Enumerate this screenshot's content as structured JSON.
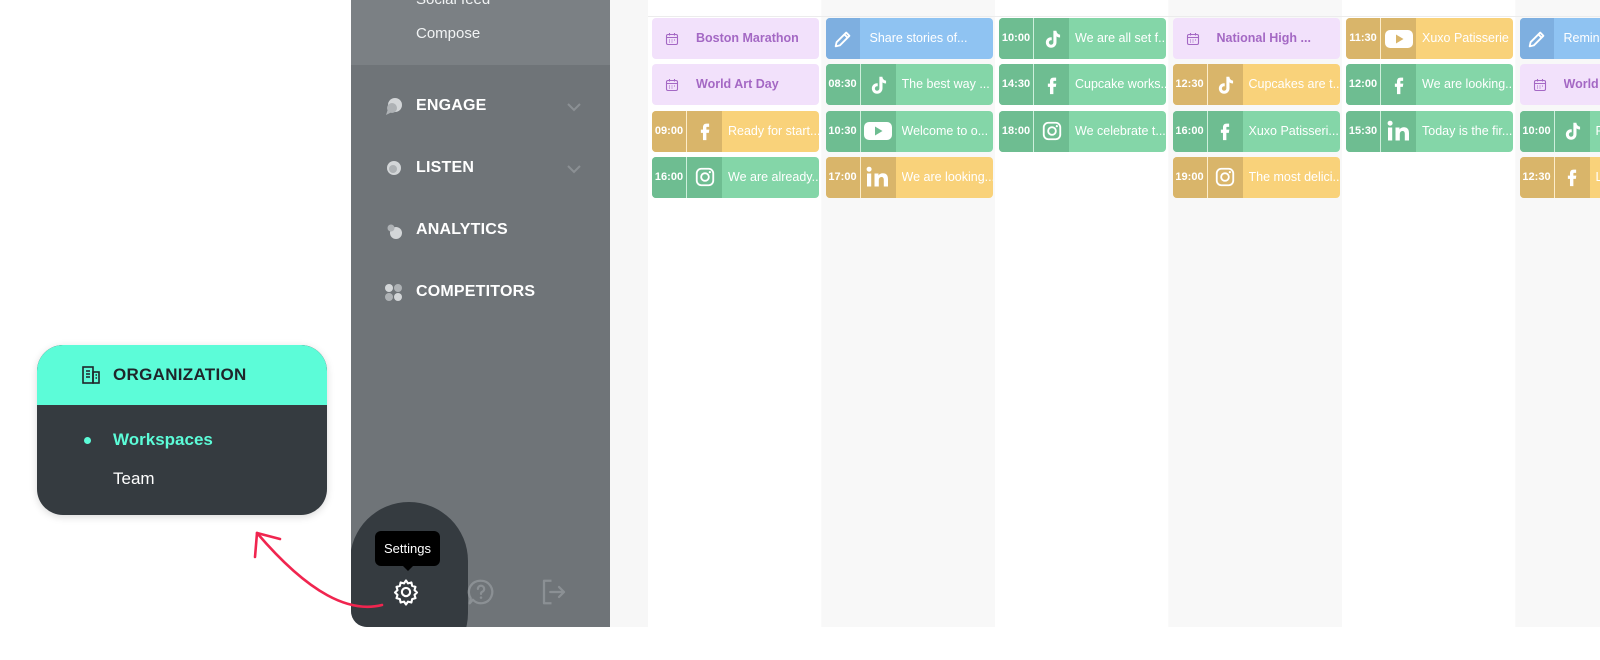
{
  "sidebar": {
    "sub_items": [
      "Social feed",
      "Compose"
    ],
    "nav": [
      {
        "label": "ENGAGE",
        "icon": "engage-icon",
        "has_chevron": true
      },
      {
        "label": "LISTEN",
        "icon": "listen-icon",
        "has_chevron": true
      },
      {
        "label": "ANALYTICS",
        "icon": "analytics-icon",
        "has_chevron": false
      },
      {
        "label": "COMPETITORS",
        "icon": "competitors-icon",
        "has_chevron": false
      }
    ],
    "footer_icons": [
      "gear-icon",
      "help-icon",
      "logout-icon"
    ]
  },
  "tooltip": "Settings",
  "organization": {
    "title": "ORGANIZATION",
    "items": [
      "Workspaces",
      "Team"
    ],
    "active": "Workspaces"
  },
  "colors": {
    "accent": "#5cfcd8",
    "sidebar_bg": "#6f7478",
    "card_bg": "#353b40",
    "arrow": "#f0254f",
    "event": "#f2e1fb",
    "event_text": "#a468c4",
    "note": "#8fc3f2",
    "green": "#84d6a8",
    "green_dark": "#6ebd91",
    "yellow": "#f9d27a",
    "yellow_dark": "#d9b56a"
  },
  "calendar": {
    "days": [
      {
        "cards": [
          {
            "kind": "event",
            "text": "Boston Marathon"
          },
          {
            "kind": "event",
            "text": "World Art Day"
          },
          {
            "kind": "post",
            "time": "09:00",
            "network": "facebook",
            "color": "yellow",
            "text": "Ready for start..."
          },
          {
            "kind": "post",
            "time": "16:00",
            "network": "instagram",
            "color": "green",
            "text": "We are already..."
          }
        ]
      },
      {
        "cards": [
          {
            "kind": "note",
            "text": "Share stories of..."
          },
          {
            "kind": "post",
            "time": "08:30",
            "network": "tiktok",
            "color": "green",
            "text": "The best way ..."
          },
          {
            "kind": "post",
            "time": "10:30",
            "network": "youtube",
            "color": "green",
            "text": "Welcome to o..."
          },
          {
            "kind": "post",
            "time": "17:00",
            "network": "linkedin",
            "color": "yellow",
            "text": "We are looking..."
          }
        ]
      },
      {
        "cards": [
          {
            "kind": "post",
            "time": "10:00",
            "network": "tiktok",
            "color": "green",
            "text": "We are all set f..."
          },
          {
            "kind": "post",
            "time": "14:30",
            "network": "facebook",
            "color": "green",
            "text": "Cupcake works..."
          },
          {
            "kind": "post",
            "time": "18:00",
            "network": "instagram",
            "color": "green",
            "text": "We celebrate t..."
          }
        ]
      },
      {
        "cards": [
          {
            "kind": "event",
            "text": "National High ..."
          },
          {
            "kind": "post",
            "time": "12:30",
            "network": "tiktok",
            "color": "yellow",
            "text": "Cupcakes are t..."
          },
          {
            "kind": "post",
            "time": "16:00",
            "network": "facebook",
            "color": "green",
            "text": "Xuxo Patisseri..."
          },
          {
            "kind": "post",
            "time": "19:00",
            "network": "instagram",
            "color": "yellow",
            "text": "The most delici..."
          }
        ]
      },
      {
        "cards": [
          {
            "kind": "post",
            "time": "11:30",
            "network": "youtube",
            "color": "yellow",
            "text": "Xuxo Patisserie"
          },
          {
            "kind": "post",
            "time": "12:00",
            "network": "facebook",
            "color": "green",
            "text": "We are looking..."
          },
          {
            "kind": "post",
            "time": "15:30",
            "network": "linkedin",
            "color": "green",
            "text": "Today is the fir..."
          }
        ]
      },
      {
        "cards": [
          {
            "kind": "note",
            "text": "Remind"
          },
          {
            "kind": "event",
            "text": "World"
          },
          {
            "kind": "post",
            "time": "10:00",
            "network": "tiktok",
            "color": "green",
            "text": "F"
          },
          {
            "kind": "post",
            "time": "12:30",
            "network": "facebook",
            "color": "yellow",
            "text": "L"
          }
        ]
      }
    ]
  }
}
